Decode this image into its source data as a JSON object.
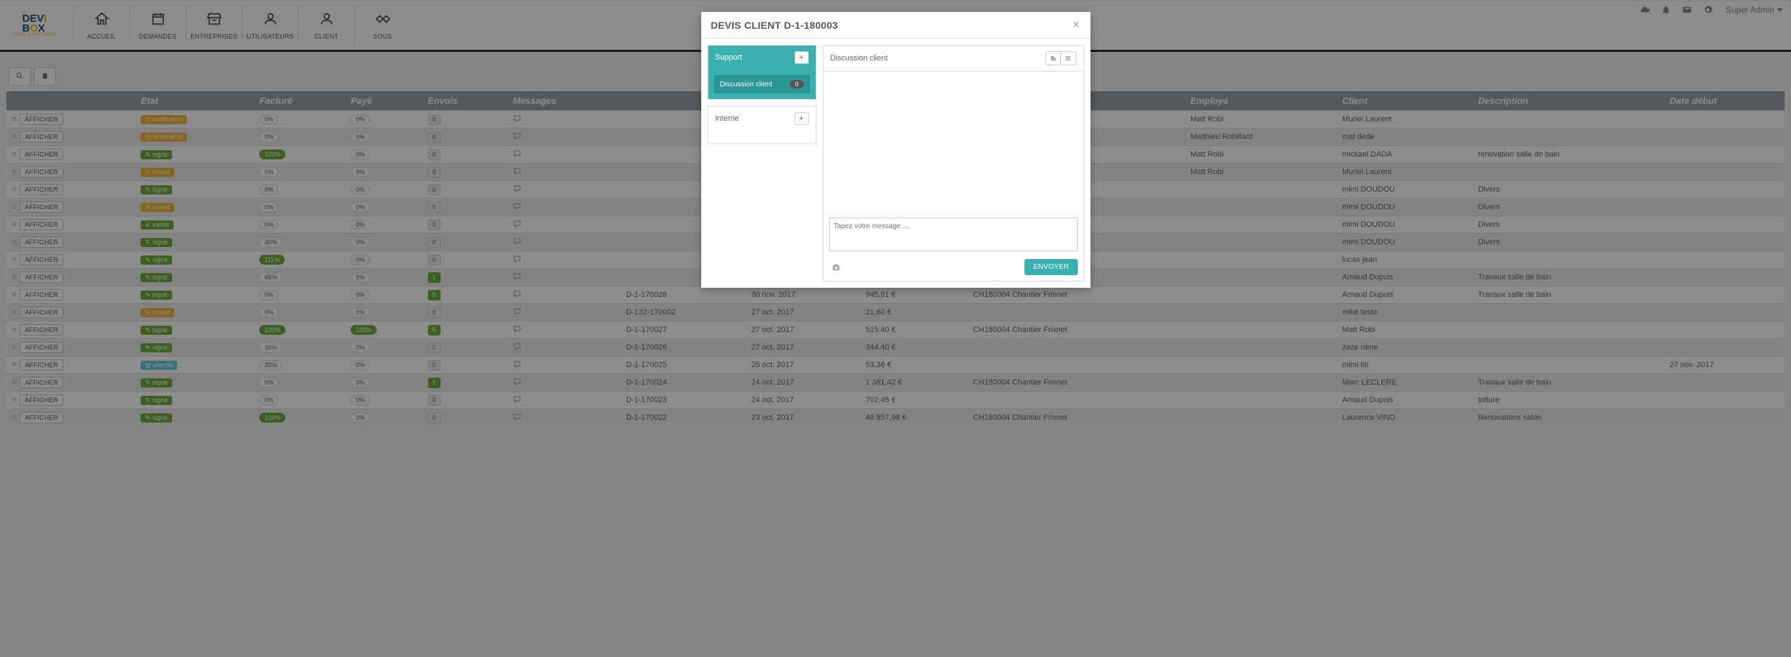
{
  "topbar": {
    "user": "Super Admin"
  },
  "nav": [
    {
      "icon": "home",
      "label": "ACCUEIL"
    },
    {
      "icon": "calendar",
      "label": "DEMANDES"
    },
    {
      "icon": "store",
      "label": "ENTREPRISES"
    },
    {
      "icon": "user",
      "label": "UTILISATEURS"
    },
    {
      "icon": "userc",
      "label": "CLIENT"
    },
    {
      "icon": "handshake",
      "label": "SOUS"
    }
  ],
  "table": {
    "headers": [
      "",
      "Etat",
      "Facturé",
      "Payé",
      "Envois",
      "Messages",
      "",
      "",
      "",
      "",
      "Employé",
      "Client",
      "Description",
      "Date début"
    ],
    "rows": [
      {
        "etat": "vérification",
        "etatCls": "b-verif",
        "fact": "0%",
        "factCls": "lt",
        "paye": "0%",
        "env": "0",
        "msg": true,
        "ref": "",
        "date": "",
        "amt": "",
        "ch": "",
        "emp": "Matt Robi",
        "cli": "Muriel Laurent",
        "desc": "",
        "dd": ""
      },
      {
        "etat": "vérification",
        "etatCls": "b-verif",
        "fact": "0%",
        "factCls": "lt",
        "paye": "0%",
        "env": "0",
        "msg": true,
        "ref": "",
        "date": "",
        "amt": "",
        "ch": "",
        "emp": "Matthieu Robillard",
        "cli": "mat dede",
        "desc": "",
        "dd": ""
      },
      {
        "etat": "signé",
        "etatCls": "b-signe",
        "fact": "100%",
        "factCls": "green",
        "paye": "0%",
        "env": "0",
        "msg": true,
        "ref": "",
        "date": "",
        "amt": "",
        "ch": "",
        "emp": "Matt Robi",
        "cli": "mickael DADA",
        "desc": "renovation salle de bain",
        "dd": ""
      },
      {
        "etat": "ouvert",
        "etatCls": "b-ouvert",
        "fact": "0%",
        "factCls": "lt",
        "paye": "0%",
        "env": "0",
        "msg": true,
        "ref": "",
        "date": "",
        "amt": "",
        "ch": "",
        "emp": "Matt Robi",
        "cli": "Muriel Laurent",
        "desc": "",
        "dd": ""
      },
      {
        "etat": "signé",
        "etatCls": "b-signe",
        "fact": "0%",
        "factCls": "lt",
        "paye": "0%",
        "env": "0",
        "msg": true,
        "ref": "",
        "date": "",
        "amt": "",
        "ch": "",
        "emp": "",
        "cli": "mimi DOUDOU",
        "desc": "Divers",
        "dd": ""
      },
      {
        "etat": "ouvert",
        "etatCls": "b-ouvert",
        "fact": "0%",
        "factCls": "lt",
        "paye": "0%",
        "env": "0",
        "msg": true,
        "ref": "",
        "date": "",
        "amt": "",
        "ch": "",
        "emp": "",
        "cli": "mimi DOUDOU",
        "desc": "Divers",
        "dd": ""
      },
      {
        "etat": "validé",
        "etatCls": "b-valide",
        "fact": "0%",
        "factCls": "lt",
        "paye": "0%",
        "env": "0",
        "msg": true,
        "ref": "",
        "date": "",
        "amt": "",
        "ch": "",
        "emp": "",
        "cli": "mimi DOUDOU",
        "desc": "Divers",
        "dd": ""
      },
      {
        "etat": "signé",
        "etatCls": "b-signe",
        "fact": "30%",
        "factCls": "lt",
        "paye": "0%",
        "env": "0",
        "msg": true,
        "ref": "",
        "date": "",
        "amt": "",
        "ch": "",
        "emp": "",
        "cli": "mimi DOUDOU",
        "desc": "Divers",
        "dd": ""
      },
      {
        "etat": "signé",
        "etatCls": "b-signe",
        "fact": "111%",
        "factCls": "green",
        "paye": "0%",
        "env": "0",
        "msg": true,
        "ref": "",
        "date": "",
        "amt": "",
        "ch": "",
        "emp": "",
        "cli": "lucas jean",
        "desc": "",
        "dd": ""
      },
      {
        "etat": "signé",
        "etatCls": "b-signe",
        "fact": "65%",
        "factCls": "lt",
        "paye": "0%",
        "env": "1",
        "envCls": "green",
        "msg": true,
        "ref": "",
        "date": "",
        "amt": "",
        "ch": "",
        "emp": "",
        "cli": "Arnaud Dupuis",
        "desc": "Travaux salle de bain",
        "dd": ""
      },
      {
        "etat": "signé",
        "etatCls": "b-signe",
        "fact": "0%",
        "factCls": "lt",
        "paye": "0%",
        "env": "5",
        "envCls": "green",
        "msg": true,
        "ref": "D-1-170028",
        "date": "30 nov. 2017",
        "amt": "945,91 €",
        "ch": "CH180004 Chantier Frixnet",
        "emp": "",
        "cli": "Arnaud Dupuis",
        "desc": "Travaux salle de bain",
        "dd": ""
      },
      {
        "etat": "ouvert",
        "etatCls": "b-ouvert",
        "fact": "0%",
        "factCls": "lt",
        "paye": "0%",
        "env": "0",
        "msg": true,
        "ref": "D-132-170002",
        "date": "27 oct. 2017",
        "amt": "21,60 €",
        "ch": "",
        "emp": "",
        "cli": "mike teste",
        "desc": "",
        "dd": ""
      },
      {
        "etat": "signé",
        "etatCls": "b-signe",
        "fact": "100%",
        "factCls": "green",
        "paye": "100%",
        "payeCls": "green",
        "env": "5",
        "envCls": "green",
        "msg": true,
        "ref": "D-1-170027",
        "date": "27 oct. 2017",
        "amt": "515,40 €",
        "ch": "CH180004 Chantier Frixnet",
        "emp": "",
        "cli": "Matt Robi",
        "desc": "",
        "dd": ""
      },
      {
        "etat": "signé",
        "etatCls": "b-signe",
        "fact": "30%",
        "factCls": "lt",
        "paye": "0%",
        "env": "0",
        "msg": true,
        "ref": "D-1-170026",
        "date": "27 oct. 2017",
        "amt": "344,40 €",
        "ch": "",
        "emp": "",
        "cli": "zeze nene",
        "desc": "",
        "dd": ""
      },
      {
        "etat": "planifié",
        "etatCls": "b-planif",
        "fact": "30%",
        "factCls": "lt",
        "paye": "0%",
        "env": "0",
        "msg": true,
        "ref": "D-1-170025",
        "date": "25 oct. 2017",
        "amt": "53,36 €",
        "ch": "",
        "emp": "",
        "cli": "mimi titi",
        "desc": "",
        "dd": "27 nov. 2017"
      },
      {
        "etat": "signé",
        "etatCls": "b-signe",
        "fact": "0%",
        "factCls": "lt",
        "paye": "0%",
        "env": "5",
        "envCls": "green",
        "msg": true,
        "ref": "D-1-170024",
        "date": "24 oct. 2017",
        "amt": "1 381,42 €",
        "ch": "CH180004 Chantier Frixnet",
        "emp": "",
        "cli": "Marc LECLERE",
        "desc": "Travaux salle de bain",
        "dd": ""
      },
      {
        "etat": "signé",
        "etatCls": "b-signe",
        "fact": "0%",
        "factCls": "lt",
        "paye": "0%",
        "env": "0",
        "msg": true,
        "ref": "D-1-170023",
        "date": "24 oct. 2017",
        "amt": "702,45 €",
        "ch": "",
        "emp": "",
        "cli": "Arnaud Dupuis",
        "desc": "toiture",
        "dd": ""
      },
      {
        "etat": "signé",
        "etatCls": "b-signe",
        "fact": "100%",
        "factCls": "green",
        "paye": "0%",
        "env": "0",
        "msg": true,
        "ref": "D-1-170022",
        "date": "23 oct. 2017",
        "amt": "49 857,98 €",
        "ch": "CH180004 Chantier Frixnet",
        "emp": "",
        "cli": "Laurence VINO",
        "desc": "Renovations salon",
        "dd": ""
      }
    ],
    "afficher": "AFFICHER"
  },
  "modal": {
    "title": "DEVIS CLIENT D-1-180003",
    "support": "Support",
    "discussionTab": "Discussion client",
    "discussionCount": "0",
    "interne": "Interne",
    "rightTitle": "Discussion client",
    "placeholder": "Tapez votre message ...",
    "send": "ENVOYER"
  }
}
